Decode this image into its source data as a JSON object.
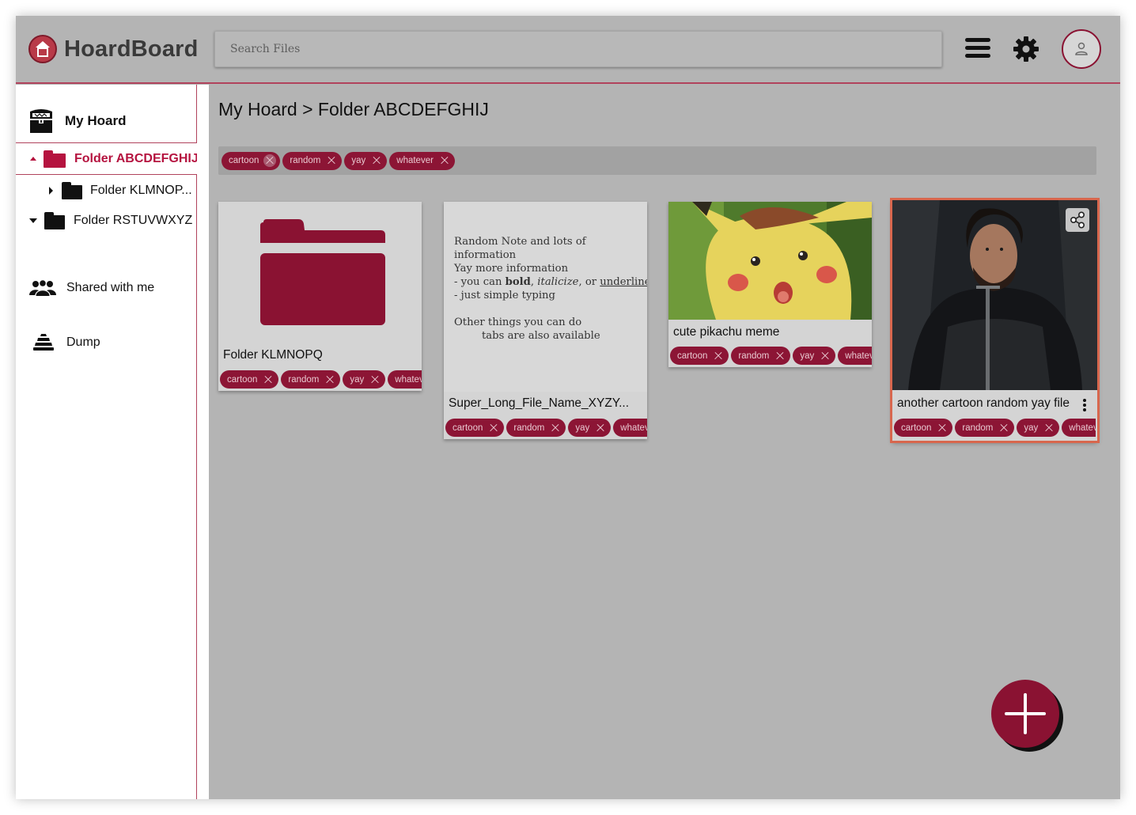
{
  "app": {
    "name": "HoardBoard"
  },
  "search": {
    "placeholder": "Search Files"
  },
  "sidebar": {
    "home": "My Hoard",
    "tree": [
      {
        "label": "Folder ABCDEFGHIJ",
        "state": "expanded",
        "active": true
      },
      {
        "label": "Folder KLMNOP...",
        "state": "collapsed",
        "active": false
      },
      {
        "label": "Folder RSTUVWXYZ",
        "state": "expanded",
        "active": false
      }
    ],
    "shared": "Shared with me",
    "dump": "Dump"
  },
  "breadcrumb": "My Hoard > Folder ABCDEFGHIJ",
  "filter_tags": [
    "cartoon",
    "random",
    "yay",
    "whatever"
  ],
  "cards": [
    {
      "type": "folder",
      "title": "Folder KLMNOPQ",
      "tags": [
        "cartoon",
        "random",
        "yay",
        "whatever"
      ]
    },
    {
      "type": "note",
      "title": "Super_Long_File_Name_XYZY...",
      "tags": [
        "cartoon",
        "random",
        "yay",
        "whatever"
      ],
      "note": {
        "line1": "Random Note and lots of information",
        "line2": "Yay more information",
        "line3_pre": "- you can ",
        "bold": "bold",
        "sep1": ", ",
        "italic": "italicize",
        "sep2": ", or ",
        "underline": "underline",
        "line4": "- just simple typing",
        "line5": "Other things you can do",
        "line6": "tabs are also available"
      }
    },
    {
      "type": "image",
      "image": "pikachu",
      "title": "cute pikachu meme",
      "tags": [
        "cartoon",
        "random",
        "yay",
        "whatever"
      ]
    },
    {
      "type": "image",
      "image": "jon-snow",
      "title": "another cartoon random yay file",
      "tags": [
        "cartoon",
        "random",
        "yay",
        "whatever"
      ],
      "selected": true
    }
  ],
  "colors": {
    "accent": "#8a1232",
    "active_text": "#b5133f",
    "selection": "#d8674e",
    "background": "#b4b4b4"
  }
}
